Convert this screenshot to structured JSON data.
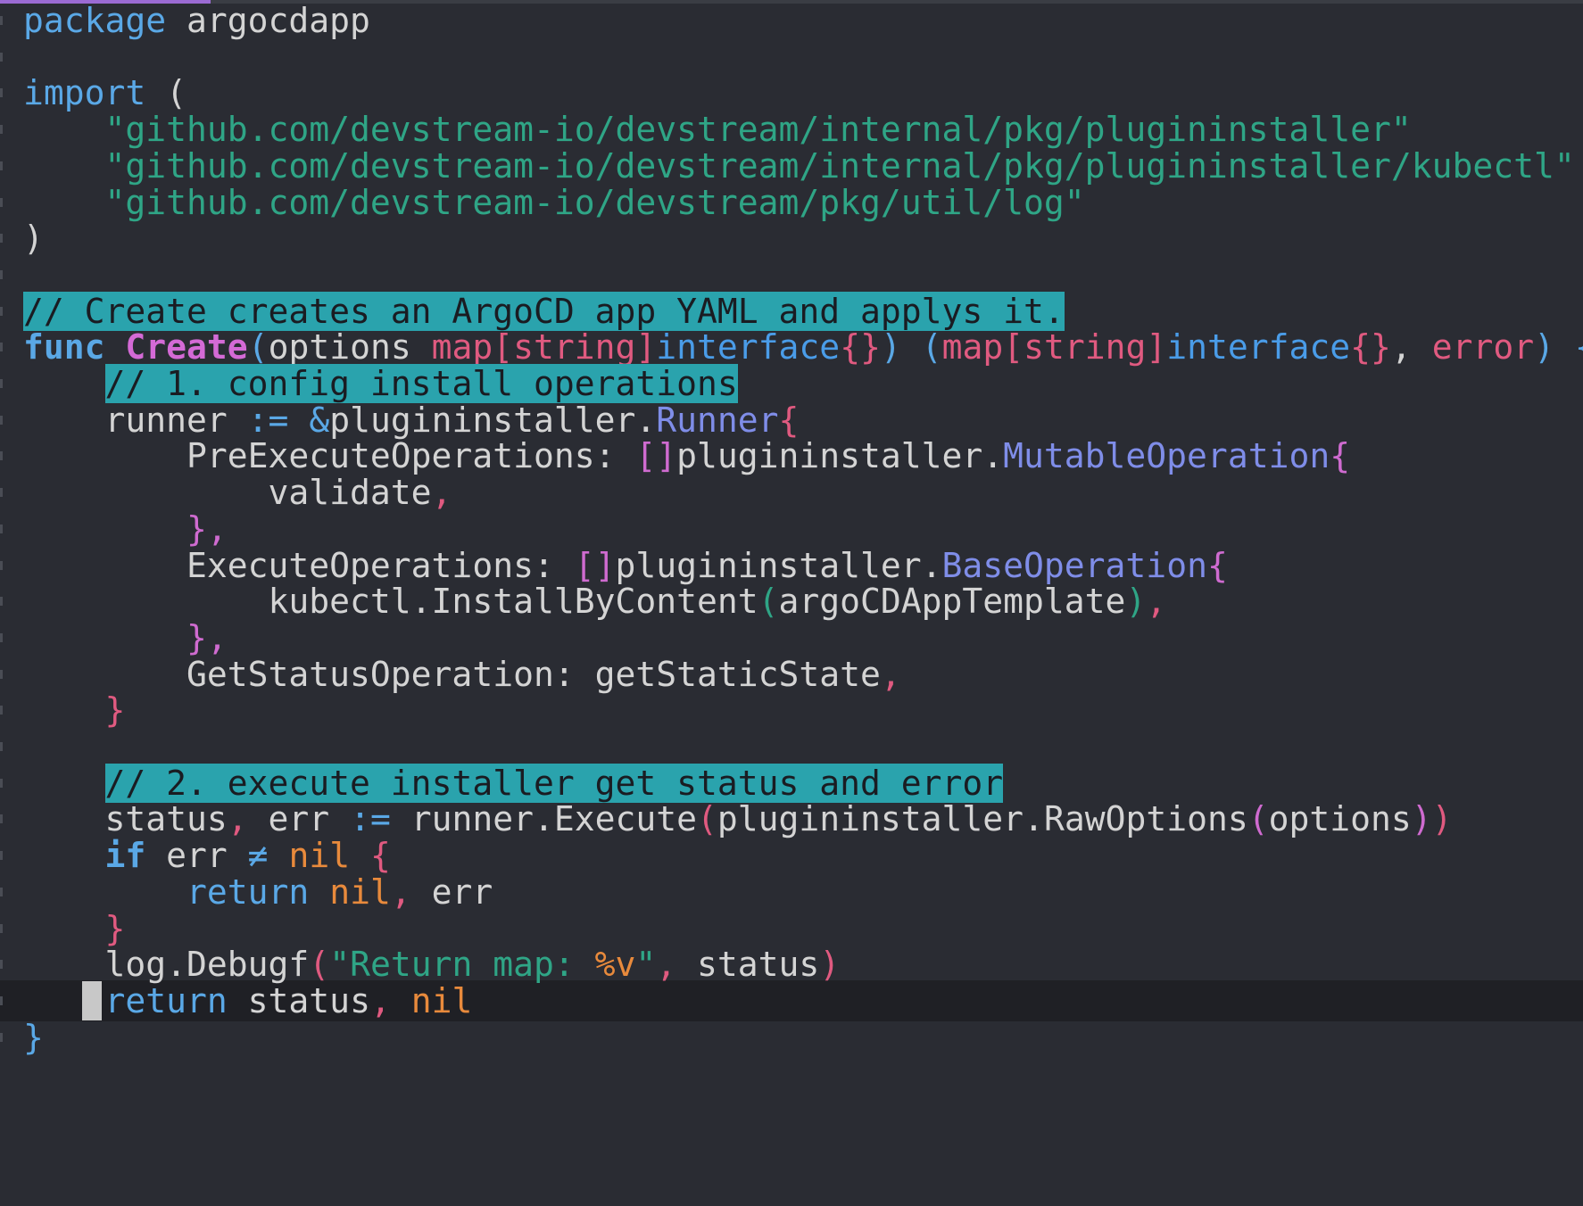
{
  "editor": {
    "lines": [
      {
        "tokens": [
          {
            "t": "package",
            "c": "kw"
          },
          {
            "t": " argocdapp",
            "c": "ident"
          }
        ]
      },
      {
        "tokens": []
      },
      {
        "tokens": [
          {
            "t": "import",
            "c": "kw"
          },
          {
            "t": " (",
            "c": "ident"
          }
        ]
      },
      {
        "tokens": [
          {
            "t": "    ",
            "c": "ident"
          },
          {
            "t": "\"github.com/devstream-io/devstream/internal/pkg/plugininstaller\"",
            "c": "str"
          }
        ]
      },
      {
        "tokens": [
          {
            "t": "    ",
            "c": "ident"
          },
          {
            "t": "\"github.com/devstream-io/devstream/internal/pkg/plugininstaller/kubectl\"",
            "c": "str"
          }
        ]
      },
      {
        "tokens": [
          {
            "t": "    ",
            "c": "ident"
          },
          {
            "t": "\"github.com/devstream-io/devstream/pkg/util/log\"",
            "c": "str"
          }
        ]
      },
      {
        "tokens": [
          {
            "t": ")",
            "c": "ident"
          }
        ]
      },
      {
        "tokens": []
      },
      {
        "tokens": [
          {
            "t": "// Create creates an ArgoCD app YAML and applys it.",
            "c": "hl"
          }
        ]
      },
      {
        "tokens": [
          {
            "t": "func",
            "c": "kwb"
          },
          {
            "t": " ",
            "c": "ident"
          },
          {
            "t": "Create",
            "c": "fn"
          },
          {
            "t": "(",
            "c": "brb"
          },
          {
            "t": "options ",
            "c": "ident"
          },
          {
            "t": "map[string]",
            "c": "typ"
          },
          {
            "t": "interface",
            "c": "iface"
          },
          {
            "t": "{}",
            "c": "br"
          },
          {
            "t": ") (",
            "c": "brb"
          },
          {
            "t": "map[string]",
            "c": "typ"
          },
          {
            "t": "interface",
            "c": "iface"
          },
          {
            "t": "{}",
            "c": "br"
          },
          {
            "t": ", ",
            "c": "ident"
          },
          {
            "t": "error",
            "c": "typ"
          },
          {
            "t": ") {",
            "c": "brb"
          }
        ]
      },
      {
        "tokens": [
          {
            "t": "    ",
            "c": "ident"
          },
          {
            "t": "// 1. config install operations",
            "c": "hl"
          }
        ]
      },
      {
        "tokens": [
          {
            "t": "    runner ",
            "c": "ident"
          },
          {
            "t": ":=",
            "c": "op"
          },
          {
            "t": " ",
            "c": "ident"
          },
          {
            "t": "&",
            "c": "op"
          },
          {
            "t": "plugininstaller.",
            "c": "ident"
          },
          {
            "t": "Runner",
            "c": "typeb"
          },
          {
            "t": "{",
            "c": "br"
          }
        ]
      },
      {
        "tokens": [
          {
            "t": "        PreExecuteOperations: ",
            "c": "ident"
          },
          {
            "t": "[]",
            "c": "pu"
          },
          {
            "t": "plugininstaller.",
            "c": "ident"
          },
          {
            "t": "MutableOperation",
            "c": "typeb"
          },
          {
            "t": "{",
            "c": "pu"
          }
        ]
      },
      {
        "tokens": [
          {
            "t": "            validate",
            "c": "ident"
          },
          {
            "t": ",",
            "c": "br"
          }
        ]
      },
      {
        "tokens": [
          {
            "t": "        ",
            "c": "ident"
          },
          {
            "t": "},",
            "c": "pu"
          }
        ]
      },
      {
        "tokens": [
          {
            "t": "        ExecuteOperations: ",
            "c": "ident"
          },
          {
            "t": "[]",
            "c": "pu"
          },
          {
            "t": "plugininstaller.",
            "c": "ident"
          },
          {
            "t": "BaseOperation",
            "c": "typeb"
          },
          {
            "t": "{",
            "c": "pu"
          }
        ]
      },
      {
        "tokens": [
          {
            "t": "            kubectl.InstallByContent",
            "c": "ident"
          },
          {
            "t": "(",
            "c": "gr"
          },
          {
            "t": "argoCDAppTemplate",
            "c": "ident"
          },
          {
            "t": ")",
            "c": "gr"
          },
          {
            "t": ",",
            "c": "br"
          }
        ]
      },
      {
        "tokens": [
          {
            "t": "        ",
            "c": "ident"
          },
          {
            "t": "},",
            "c": "pu"
          }
        ]
      },
      {
        "tokens": [
          {
            "t": "        GetStatusOperation: getStaticState",
            "c": "ident"
          },
          {
            "t": ",",
            "c": "br"
          }
        ]
      },
      {
        "tokens": [
          {
            "t": "    ",
            "c": "ident"
          },
          {
            "t": "}",
            "c": "br"
          }
        ]
      },
      {
        "tokens": []
      },
      {
        "tokens": [
          {
            "t": "    ",
            "c": "ident"
          },
          {
            "t": "// 2. execute installer get status and error",
            "c": "hl"
          }
        ]
      },
      {
        "tokens": [
          {
            "t": "    status",
            "c": "ident"
          },
          {
            "t": ",",
            "c": "br"
          },
          {
            "t": " err ",
            "c": "ident"
          },
          {
            "t": ":=",
            "c": "op"
          },
          {
            "t": " runner.Execute",
            "c": "ident"
          },
          {
            "t": "(",
            "c": "br"
          },
          {
            "t": "plugininstaller.RawOptions",
            "c": "ident"
          },
          {
            "t": "(",
            "c": "pu"
          },
          {
            "t": "options",
            "c": "ident"
          },
          {
            "t": ")",
            "c": "pu"
          },
          {
            "t": ")",
            "c": "br"
          }
        ]
      },
      {
        "tokens": [
          {
            "t": "    ",
            "c": "ident"
          },
          {
            "t": "if",
            "c": "kwb"
          },
          {
            "t": " err ",
            "c": "ident"
          },
          {
            "t": "≠",
            "c": "op"
          },
          {
            "t": " ",
            "c": "ident"
          },
          {
            "t": "nil",
            "c": "nil"
          },
          {
            "t": " ",
            "c": "ident"
          },
          {
            "t": "{",
            "c": "br"
          }
        ]
      },
      {
        "tokens": [
          {
            "t": "        ",
            "c": "ident"
          },
          {
            "t": "return",
            "c": "kw"
          },
          {
            "t": " ",
            "c": "ident"
          },
          {
            "t": "nil",
            "c": "nil"
          },
          {
            "t": ",",
            "c": "br"
          },
          {
            "t": " err",
            "c": "ident"
          }
        ]
      },
      {
        "tokens": [
          {
            "t": "    ",
            "c": "ident"
          },
          {
            "t": "}",
            "c": "br"
          }
        ]
      },
      {
        "tokens": [
          {
            "t": "    log.Debugf",
            "c": "ident"
          },
          {
            "t": "(",
            "c": "br"
          },
          {
            "t": "\"Return map: ",
            "c": "str"
          },
          {
            "t": "%v",
            "c": "nil"
          },
          {
            "t": "\"",
            "c": "str"
          },
          {
            "t": ",",
            "c": "br"
          },
          {
            "t": " status",
            "c": "ident"
          },
          {
            "t": ")",
            "c": "br"
          }
        ]
      },
      {
        "tokens": [
          {
            "t": "    ",
            "c": "ident"
          },
          {
            "t": "return",
            "c": "kw"
          },
          {
            "t": " status",
            "c": "ident"
          },
          {
            "t": ",",
            "c": "br"
          },
          {
            "t": " ",
            "c": "ident"
          },
          {
            "t": "nil",
            "c": "nil"
          }
        ]
      },
      {
        "tokens": [
          {
            "t": "}",
            "c": "brb"
          }
        ]
      }
    ]
  }
}
